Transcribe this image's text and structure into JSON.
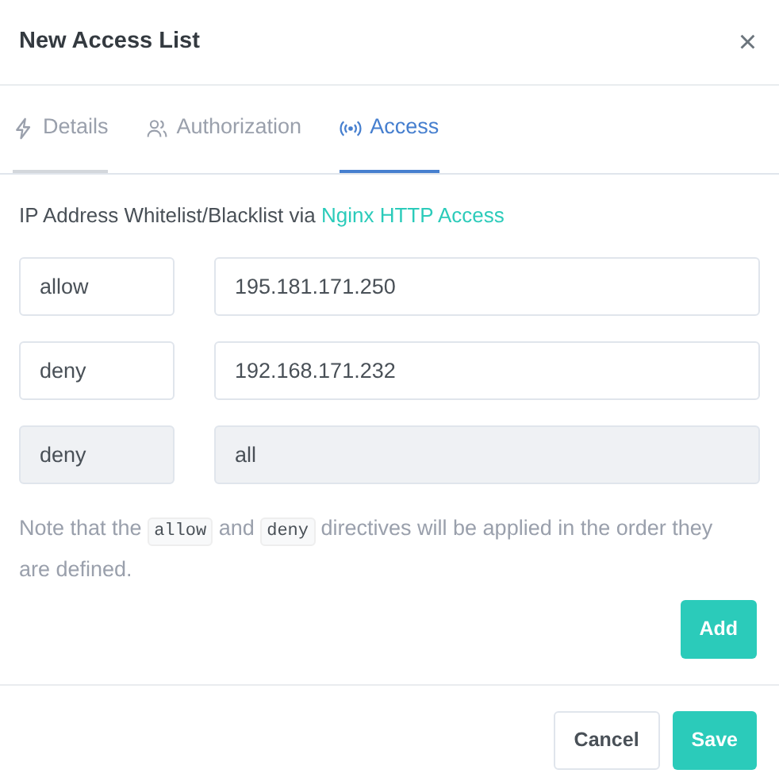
{
  "modal": {
    "title": "New Access List",
    "close": "×"
  },
  "tabs": [
    {
      "label": "Details",
      "selected": false,
      "hovered": true
    },
    {
      "label": "Authorization",
      "selected": false,
      "hovered": false
    },
    {
      "label": "Access",
      "selected": true,
      "hovered": false
    }
  ],
  "description": {
    "text": "IP Address Whitelist/Blacklist via",
    "link": "Nginx HTTP Access"
  },
  "rules": [
    {
      "directive": "allow",
      "address": "195.181.171.250",
      "disabled": false
    },
    {
      "directive": "deny",
      "address": "192.168.171.232",
      "disabled": false
    },
    {
      "directive": "deny",
      "address": "all",
      "disabled": true
    }
  ],
  "note": [
    {
      "kind": "text",
      "text": "Note that the "
    },
    {
      "kind": "code",
      "text": "allow"
    },
    {
      "kind": "text",
      "text": " and "
    },
    {
      "kind": "code",
      "text": "deny"
    },
    {
      "kind": "text",
      "text": " directives will be applied in the order they are defined."
    }
  ],
  "add_button": "Add",
  "footer_buttons": [
    {
      "label": "Cancel",
      "kind": "secondary"
    },
    {
      "label": "Save",
      "kind": "primary"
    }
  ]
}
